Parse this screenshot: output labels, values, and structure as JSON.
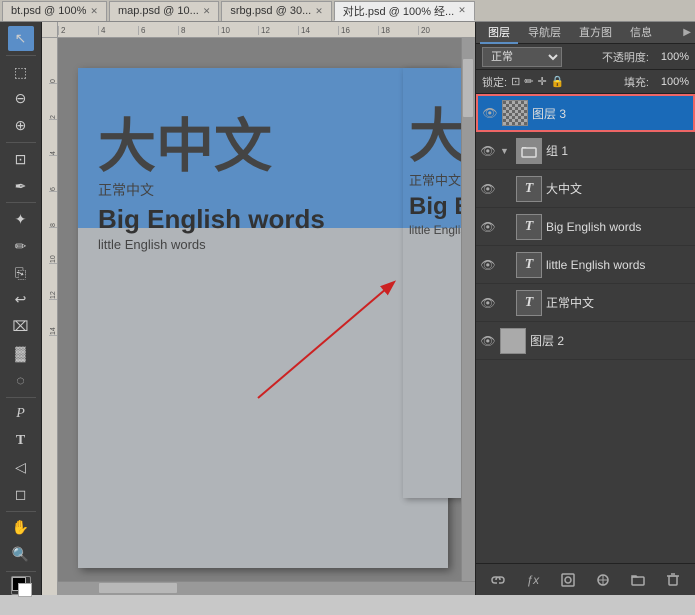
{
  "tabs": [
    {
      "label": "bt.psd @ 100%",
      "active": false
    },
    {
      "label": "map.psd @ 10...",
      "active": false
    },
    {
      "label": "srbg.psd @ 30...",
      "active": false
    },
    {
      "label": "对比.psd @ 100% 经...",
      "active": true
    }
  ],
  "toolbar_tools": [
    {
      "icon": "↖",
      "name": "move-tool",
      "active": true
    },
    {
      "icon": "⬚",
      "name": "marquee-tool",
      "active": false
    },
    {
      "icon": "✂",
      "name": "lasso-tool",
      "active": false
    },
    {
      "icon": "⊕",
      "name": "quick-select-tool",
      "active": false
    },
    {
      "icon": "✂",
      "name": "crop-tool",
      "active": false
    },
    {
      "icon": "✒",
      "name": "eyedropper-tool",
      "active": false
    },
    {
      "icon": "⊘",
      "name": "healing-tool",
      "active": false
    },
    {
      "icon": "✏",
      "name": "brush-tool",
      "active": false
    },
    {
      "icon": "♦",
      "name": "clone-tool",
      "active": false
    },
    {
      "icon": "⌧",
      "name": "eraser-tool",
      "active": false
    },
    {
      "icon": "▓",
      "name": "gradient-tool",
      "active": false
    },
    {
      "icon": "◌",
      "name": "dodge-tool",
      "active": false
    },
    {
      "icon": "P",
      "name": "pen-tool",
      "active": false
    },
    {
      "icon": "T",
      "name": "text-tool",
      "active": false
    },
    {
      "icon": "◻",
      "name": "shape-tool",
      "active": false
    },
    {
      "icon": "☞",
      "name": "hand-tool",
      "active": false
    },
    {
      "icon": "⊕",
      "name": "zoom-tool",
      "active": false
    }
  ],
  "canvas": {
    "big_chinese": "大中文",
    "normal_chinese": "正常中文",
    "big_english": "Big English words",
    "small_english": "little English words",
    "big_chinese_2": "大",
    "normal_chinese_2": "正常中文",
    "big_english_2": "Big En",
    "small_english_2": "little English w"
  },
  "panel_tabs": [
    {
      "label": "图层",
      "active": true
    },
    {
      "label": "导航层",
      "active": false
    },
    {
      "label": "直方图",
      "active": false
    },
    {
      "label": "信息",
      "active": false
    }
  ],
  "layers_panel": {
    "mode_label": "正常",
    "opacity_label": "不透明度:",
    "opacity_value": "100%",
    "lock_label": "锁定:",
    "fill_label": "填充:",
    "fill_value": "100%",
    "layers": [
      {
        "name": "图层 3",
        "type": "raster",
        "selected": true,
        "eye": true,
        "indent": 0,
        "thumbnail": "checkerboard"
      },
      {
        "name": "组 1",
        "type": "group",
        "selected": false,
        "eye": true,
        "indent": 0,
        "thumbnail": "folder"
      },
      {
        "name": "大中文",
        "type": "text",
        "selected": false,
        "eye": true,
        "indent": 1,
        "thumbnail": "T"
      },
      {
        "name": "Big English words",
        "type": "text",
        "selected": false,
        "eye": true,
        "indent": 1,
        "thumbnail": "T"
      },
      {
        "name": "little English words",
        "type": "text",
        "selected": false,
        "eye": true,
        "indent": 1,
        "thumbnail": "T"
      },
      {
        "name": "正常中文",
        "type": "text",
        "selected": false,
        "eye": true,
        "indent": 1,
        "thumbnail": "T"
      },
      {
        "name": "图层 2",
        "type": "raster",
        "selected": false,
        "eye": true,
        "indent": 0,
        "thumbnail": "gray"
      }
    ]
  },
  "bottom_buttons": [
    "🔗",
    "ƒx",
    "⬚",
    "◎",
    "🗁",
    "🗑"
  ]
}
